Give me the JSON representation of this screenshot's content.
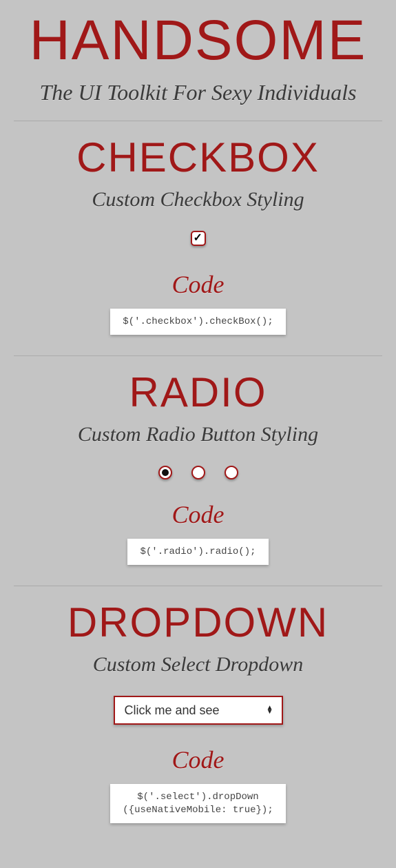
{
  "header": {
    "title": "HANDSOME",
    "tagline": "The UI Toolkit For Sexy Individuals"
  },
  "sections": {
    "checkbox": {
      "title": "CHECKBOX",
      "subtitle": "Custom Checkbox Styling",
      "checked": true,
      "code_label": "Code",
      "code": "$('.checkbox').checkBox();"
    },
    "radio": {
      "title": "RADIO",
      "subtitle": "Custom Radio Button Styling",
      "selected_index": 0,
      "options_count": 3,
      "code_label": "Code",
      "code": "$('.radio').radio();"
    },
    "dropdown": {
      "title": "DROPDOWN",
      "subtitle": "Custom Select Dropdown",
      "selected_label": "Click me and see",
      "code_label": "Code",
      "code": "$('.select').dropDown\n({useNativeMobile: true});"
    }
  }
}
